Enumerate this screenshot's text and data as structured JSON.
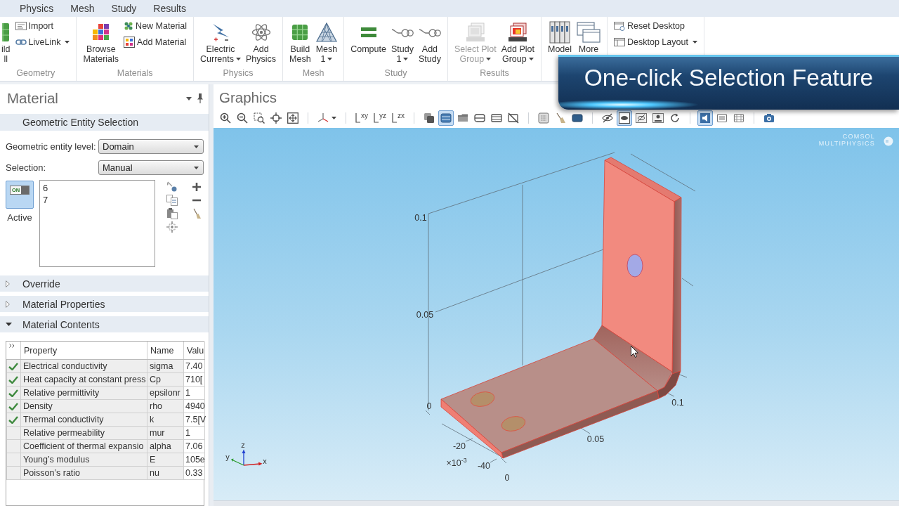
{
  "ribbon_tabs": [
    "Physics",
    "Mesh",
    "Study",
    "Results"
  ],
  "ribbon_groups": [
    {
      "label": "Geometry",
      "items": [
        {
          "kind": "large",
          "lines": [
            "ild",
            "ll"
          ],
          "dropdown": false,
          "disabled": false
        },
        {
          "kind": "small",
          "lines": [
            "Import"
          ],
          "dropdown": false,
          "disabled": false
        },
        {
          "kind": "small",
          "lines": [
            "LiveLink"
          ],
          "dropdown": true,
          "disabled": false
        }
      ]
    },
    {
      "label": "Materials",
      "items": [
        {
          "kind": "large",
          "lines": [
            "Browse",
            "Materials"
          ],
          "dropdown": false,
          "disabled": false
        },
        {
          "kind": "small",
          "lines": [
            "New Material"
          ],
          "dropdown": false,
          "disabled": false
        },
        {
          "kind": "small",
          "lines": [
            "Add Material"
          ],
          "dropdown": false,
          "disabled": false
        }
      ]
    },
    {
      "label": "Physics",
      "items": [
        {
          "kind": "large",
          "lines": [
            "Electric",
            "Currents"
          ],
          "dropdown": true,
          "disabled": false
        },
        {
          "kind": "large",
          "lines": [
            "Add",
            "Physics"
          ],
          "dropdown": false,
          "disabled": false
        }
      ]
    },
    {
      "label": "Mesh",
      "items": [
        {
          "kind": "large",
          "lines": [
            "Build",
            "Mesh"
          ],
          "dropdown": false,
          "disabled": false
        },
        {
          "kind": "large",
          "lines": [
            "Mesh",
            "1"
          ],
          "dropdown": true,
          "disabled": false
        }
      ]
    },
    {
      "label": "Study",
      "items": [
        {
          "kind": "large",
          "lines": [
            "Compute"
          ],
          "dropdown": false,
          "disabled": false
        },
        {
          "kind": "large",
          "lines": [
            "Study",
            "1"
          ],
          "dropdown": true,
          "disabled": false
        },
        {
          "kind": "large",
          "lines": [
            "Add",
            "Study"
          ],
          "dropdown": false,
          "disabled": false
        }
      ]
    },
    {
      "label": "Results",
      "items": [
        {
          "kind": "large",
          "lines": [
            "Select Plot",
            "Group"
          ],
          "dropdown": true,
          "disabled": true
        },
        {
          "kind": "large",
          "lines": [
            "Add Plot",
            "Group"
          ],
          "dropdown": true,
          "disabled": false
        }
      ]
    },
    {
      "items": [
        {
          "kind": "large",
          "lines": [
            "Model"
          ],
          "dropdown": false,
          "disabled": false
        },
        {
          "kind": "large",
          "lines": [
            "More"
          ],
          "dropdown": false,
          "disabled": false
        }
      ]
    },
    {
      "items": [
        {
          "kind": "small",
          "lines": [
            "Reset Desktop"
          ],
          "dropdown": false,
          "disabled": false
        },
        {
          "kind": "small",
          "lines": [
            "Desktop Layout"
          ],
          "dropdown": true,
          "disabled": false
        }
      ]
    }
  ],
  "settings_panel": {
    "title": "Material",
    "selection_section": {
      "title": "Geometric Entity Selection",
      "fields": [
        {
          "label": "Geometric entity level:",
          "value": "Domain"
        },
        {
          "label": "Selection:",
          "value": "Manual"
        }
      ],
      "active_toggle": {
        "label": "Active",
        "switch_text": "ON",
        "on": true
      },
      "selection_list": [
        "6",
        "7"
      ]
    },
    "sections": [
      {
        "title": "Override",
        "expanded": false
      },
      {
        "title": "Material Properties",
        "expanded": false
      },
      {
        "title": "Material Contents",
        "expanded": true,
        "table": {
          "columns": [
            "Property",
            "Name",
            "Valu"
          ],
          "rows": [
            {
              "checked": true,
              "property": "Electrical conductivity",
              "name": "sigma",
              "value": "7.40"
            },
            {
              "checked": true,
              "property": "Heat capacity at constant press",
              "name": "Cp",
              "value": "710["
            },
            {
              "checked": true,
              "property": "Relative permittivity",
              "name": "epsilonr",
              "value": "1"
            },
            {
              "checked": true,
              "property": "Density",
              "name": "rho",
              "value": "4940"
            },
            {
              "checked": true,
              "property": "Thermal conductivity",
              "name": "k",
              "value": "7.5[V"
            },
            {
              "checked": false,
              "property": "Relative permeability",
              "name": "mur",
              "value": "1"
            },
            {
              "checked": false,
              "property": "Coefficient of thermal expansio",
              "name": "alpha",
              "value": "7.06"
            },
            {
              "checked": false,
              "property": "Young’s modulus",
              "name": "E",
              "value": "105e"
            },
            {
              "checked": false,
              "property": "Poisson’s ratio",
              "name": "nu",
              "value": "0.33"
            }
          ]
        }
      }
    ]
  },
  "graphics": {
    "title": "Graphics",
    "toolbar": [
      [
        {
          "selected": false
        },
        {
          "selected": false
        },
        {
          "selected": false
        },
        {
          "selected": false
        },
        {
          "selected": false
        }
      ],
      [
        {
          "selected": false,
          "dropdown": true
        }
      ],
      [
        {
          "label": "xy",
          "selected": false
        },
        {
          "label": "yz",
          "selected": false
        },
        {
          "label": "zx",
          "selected": false
        }
      ],
      [
        {
          "selected": false
        },
        {
          "selected": true
        },
        {
          "selected": false
        },
        {
          "selected": false
        },
        {
          "selected": false
        },
        {
          "selected": false
        }
      ],
      [
        {
          "selected": false
        },
        {
          "selected": false
        },
        {
          "selected": false
        }
      ],
      [
        {
          "selected": false
        },
        {
          "selected": true
        },
        {
          "selected": false
        },
        {
          "selected": false
        },
        {
          "selected": false
        }
      ],
      [
        {
          "selected": true
        },
        {
          "selected": false
        },
        {
          "selected": false
        }
      ],
      [
        {
          "selected": false
        }
      ]
    ],
    "logo": [
      "COMSOL",
      "MULTIPHYSICS"
    ],
    "axis_tick_labels": [
      "0.1",
      "0.05",
      "0",
      "0.1",
      "0.05",
      "-20",
      "×10$^{-3}$",
      "-40",
      "0"
    ],
    "axis_triad": [
      "z",
      "y",
      "x"
    ]
  },
  "overlay_banner": {
    "title": "One-click Selection Feature"
  }
}
